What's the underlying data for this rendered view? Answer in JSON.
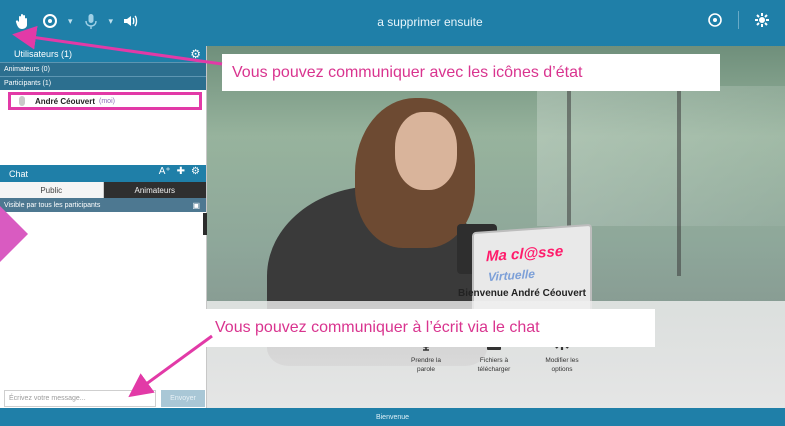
{
  "topbar": {
    "title": "a supprimer ensuite",
    "icons": [
      "hand-icon",
      "status-icon",
      "mic-icon",
      "volume-icon",
      "share-icon",
      "gear-icon"
    ]
  },
  "users_panel": {
    "header": "Utilisateurs (1)",
    "animators_label": "Animateurs (0)",
    "participants_label": "Participants (1)",
    "user_name": "André Céouvert",
    "user_suffix": "(moi)"
  },
  "chat_panel": {
    "header": "Chat",
    "font_size_tool": "A⁺",
    "tabs": [
      "Public",
      "Animateurs"
    ],
    "visibility_note": "Visible par tous les participants",
    "input_placeholder": "Écrivez votre message...",
    "send_label": "Envoyer"
  },
  "main": {
    "welcome": "Bienvenue André Céouvert",
    "brand_line1": "Ma cl@sse",
    "brand_line2": "Virtuelle",
    "actions": [
      {
        "icon": "microphone-icon",
        "label": "Prendre la parole"
      },
      {
        "icon": "download-icon",
        "label": "Fichiers à télécharger"
      },
      {
        "icon": "settings-icon",
        "label": "Modifier les options"
      }
    ]
  },
  "footer": {
    "label": "Bienvenue"
  },
  "annotations": {
    "callout_1": "Vous pouvez communiquer avec les icônes d’état",
    "callout_2": "Vous pouvez communiquer à l’écrit via le chat",
    "accent_color": "#e23aa7"
  },
  "colors": {
    "primary": "#1f7fa8",
    "panel_dark": "#2c6f8f"
  }
}
